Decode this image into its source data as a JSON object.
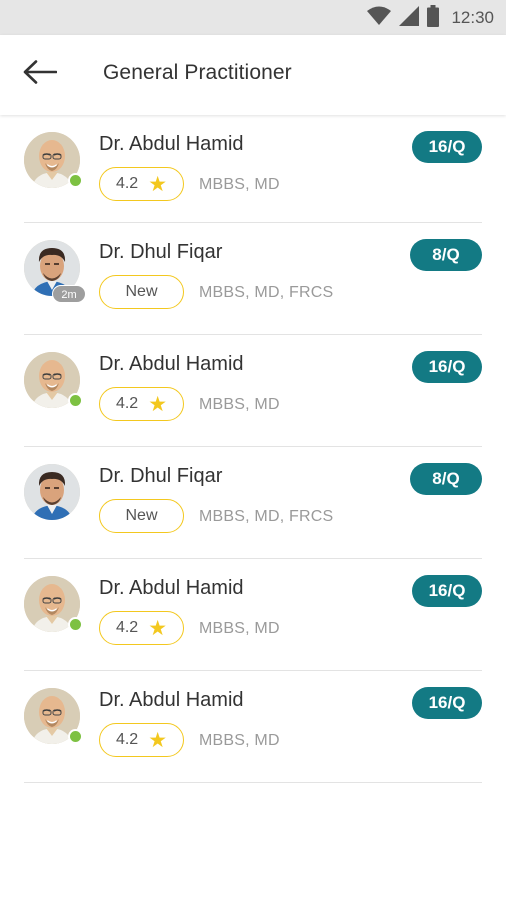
{
  "status_bar": {
    "time": "12:30",
    "icons": [
      "wifi-icon",
      "signal-icon",
      "battery-icon"
    ]
  },
  "header": {
    "back_icon": "arrow-left-icon",
    "title": "General Practitioner"
  },
  "colors": {
    "accent": "#137a84",
    "star": "#f3c81f",
    "online": "#7dc142",
    "divider": "#e3e3e3"
  },
  "doctors": [
    {
      "name": "Dr. Abdul Hamid",
      "badge": "4.2",
      "badge_type": "rating",
      "qualifications": "MBBS, MD",
      "price": "16/Q",
      "presence": "online"
    },
    {
      "name": "Dr. Dhul Fiqar",
      "badge": "New",
      "badge_type": "new",
      "qualifications": "MBBS, MD, FRCS",
      "price": "8/Q",
      "presence": "away",
      "last_seen": "2m"
    },
    {
      "name": "Dr. Abdul Hamid",
      "badge": "4.2",
      "badge_type": "rating",
      "qualifications": "MBBS, MD",
      "price": "16/Q",
      "presence": "online"
    },
    {
      "name": "Dr. Dhul Fiqar",
      "badge": "New",
      "badge_type": "new",
      "qualifications": "MBBS, MD, FRCS",
      "price": "8/Q",
      "presence": "none"
    },
    {
      "name": "Dr. Abdul Hamid",
      "badge": "4.2",
      "badge_type": "rating",
      "qualifications": "MBBS, MD",
      "price": "16/Q",
      "presence": "online"
    },
    {
      "name": "Dr. Abdul Hamid",
      "badge": "4.2",
      "badge_type": "rating",
      "qualifications": "MBBS, MD",
      "price": "16/Q",
      "presence": "online"
    }
  ]
}
